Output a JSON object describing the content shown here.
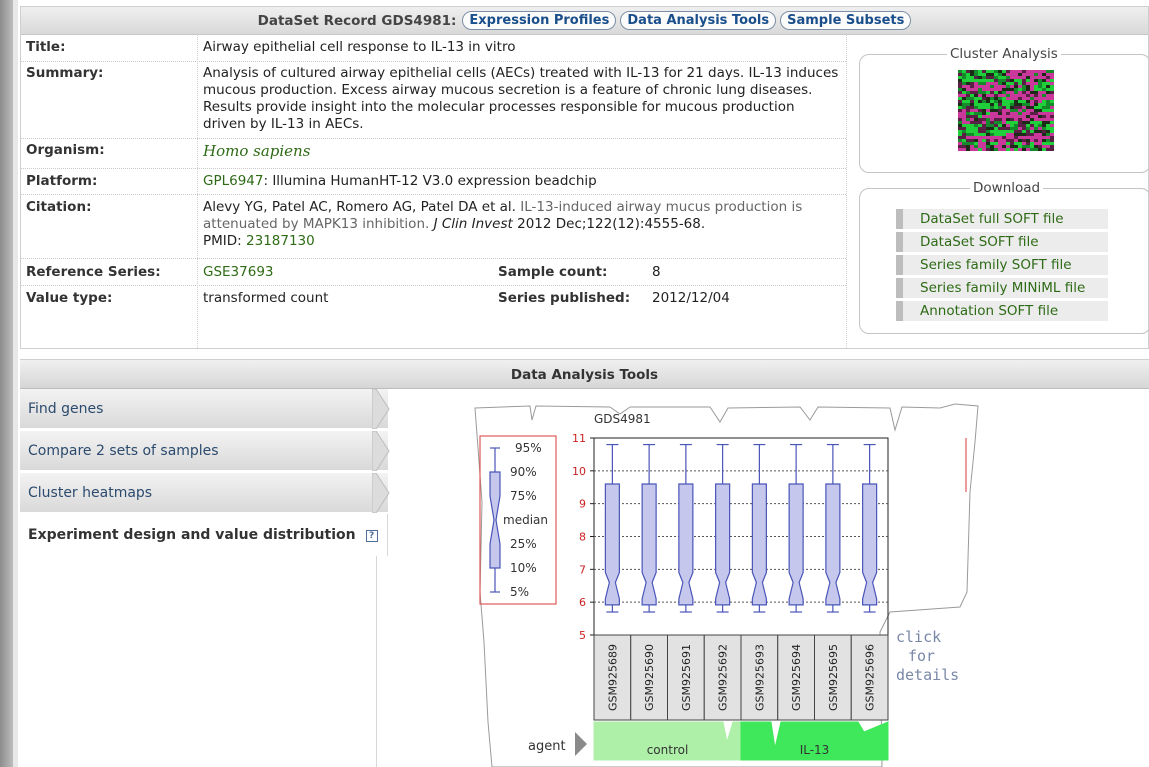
{
  "header": {
    "title": "DataSet Record GDS4981:",
    "buttons": [
      "Expression Profiles",
      "Data Analysis Tools",
      "Sample Subsets"
    ]
  },
  "fields": {
    "title_label": "Title:",
    "title_value": "Airway epithelial cell response to IL-13 in vitro",
    "summary_label": "Summary:",
    "summary_value": "Analysis of cultured airway epithelial cells (AECs) treated with IL-13 for 21 days. IL-13 induces mucous production. Excess airway mucous secretion is a feature of chronic lung diseases. Results provide insight into the molecular processes responsible for mucous production driven by IL-13 in AECs.",
    "organism_label": "Organism:",
    "organism_value": "Homo sapiens",
    "platform_label": "Platform:",
    "platform_link": "GPL6947",
    "platform_text": ": Illumina HumanHT-12 V3.0 expression beadchip",
    "citation_label": "Citation:",
    "citation_authors": "Alevy YG, Patel AC, Romero AG, Patel DA et al.",
    "citation_title": "IL-13-induced airway mucus production is attenuated by MAPK13 inhibition.",
    "citation_journal": "J Clin Invest",
    "citation_ref": "2012 Dec;122(12):4555-68.",
    "pmid_label": "PMID:",
    "pmid_value": "23187130",
    "refseries_label": "Reference Series:",
    "refseries_value": "GSE37693",
    "samplecount_label": "Sample count:",
    "samplecount_value": "8",
    "valuetype_label": "Value type:",
    "valuetype_value": "transformed count",
    "published_label": "Series published:",
    "published_value": "2012/12/04"
  },
  "cluster": {
    "legend": "Cluster Analysis"
  },
  "download": {
    "legend": "Download",
    "items": [
      "DataSet full SOFT file",
      "DataSet SOFT file",
      "Series family SOFT file",
      "Series family MINiML file",
      "Annotation SOFT file"
    ]
  },
  "tools": {
    "header": "Data Analysis Tools",
    "tabs": [
      "Find genes",
      "Compare 2 sets of samples",
      "Cluster heatmaps"
    ],
    "active_tab": "Experiment design and value distribution"
  },
  "legend_box": {
    "labels": [
      "95%",
      "90%",
      "75%",
      "median",
      "25%",
      "10%",
      "5%"
    ]
  },
  "plot": {
    "title": "GDS4981",
    "click_text": [
      "click",
      "for",
      "details"
    ],
    "agent_label": "agent",
    "groups": [
      {
        "name": "control",
        "color": "#aef0a8"
      },
      {
        "name": "IL-13",
        "color": "#3ee85a"
      }
    ]
  },
  "chart_data": {
    "type": "box",
    "title": "GDS4981",
    "ylim": [
      5,
      11
    ],
    "yticks": [
      5,
      6,
      7,
      8,
      9,
      10,
      11
    ],
    "categories": [
      "GSM925689",
      "GSM925690",
      "GSM925691",
      "GSM925692",
      "GSM925693",
      "GSM925694",
      "GSM925695",
      "GSM925696"
    ],
    "groups": [
      "control",
      "control",
      "control",
      "control",
      "IL-13",
      "IL-13",
      "IL-13",
      "IL-13"
    ],
    "boxes": [
      {
        "p5": 5.7,
        "p10": 5.8,
        "p25": 6.1,
        "median": 6.6,
        "p75": 9.6,
        "p90": 10.4,
        "p95": 10.8
      },
      {
        "p5": 5.7,
        "p10": 5.8,
        "p25": 6.1,
        "median": 6.6,
        "p75": 9.6,
        "p90": 10.4,
        "p95": 10.8
      },
      {
        "p5": 5.7,
        "p10": 5.8,
        "p25": 6.1,
        "median": 6.6,
        "p75": 9.6,
        "p90": 10.4,
        "p95": 10.8
      },
      {
        "p5": 5.7,
        "p10": 5.8,
        "p25": 6.1,
        "median": 6.6,
        "p75": 9.6,
        "p90": 10.4,
        "p95": 10.8
      },
      {
        "p5": 5.7,
        "p10": 5.8,
        "p25": 6.1,
        "median": 6.6,
        "p75": 9.6,
        "p90": 10.4,
        "p95": 10.8
      },
      {
        "p5": 5.7,
        "p10": 5.8,
        "p25": 6.1,
        "median": 6.6,
        "p75": 9.6,
        "p90": 10.4,
        "p95": 10.8
      },
      {
        "p5": 5.7,
        "p10": 5.8,
        "p25": 6.1,
        "median": 6.6,
        "p75": 9.6,
        "p90": 10.4,
        "p95": 10.8
      },
      {
        "p5": 5.7,
        "p10": 5.8,
        "p25": 6.1,
        "median": 6.6,
        "p75": 9.6,
        "p90": 10.4,
        "p95": 10.8
      }
    ]
  }
}
